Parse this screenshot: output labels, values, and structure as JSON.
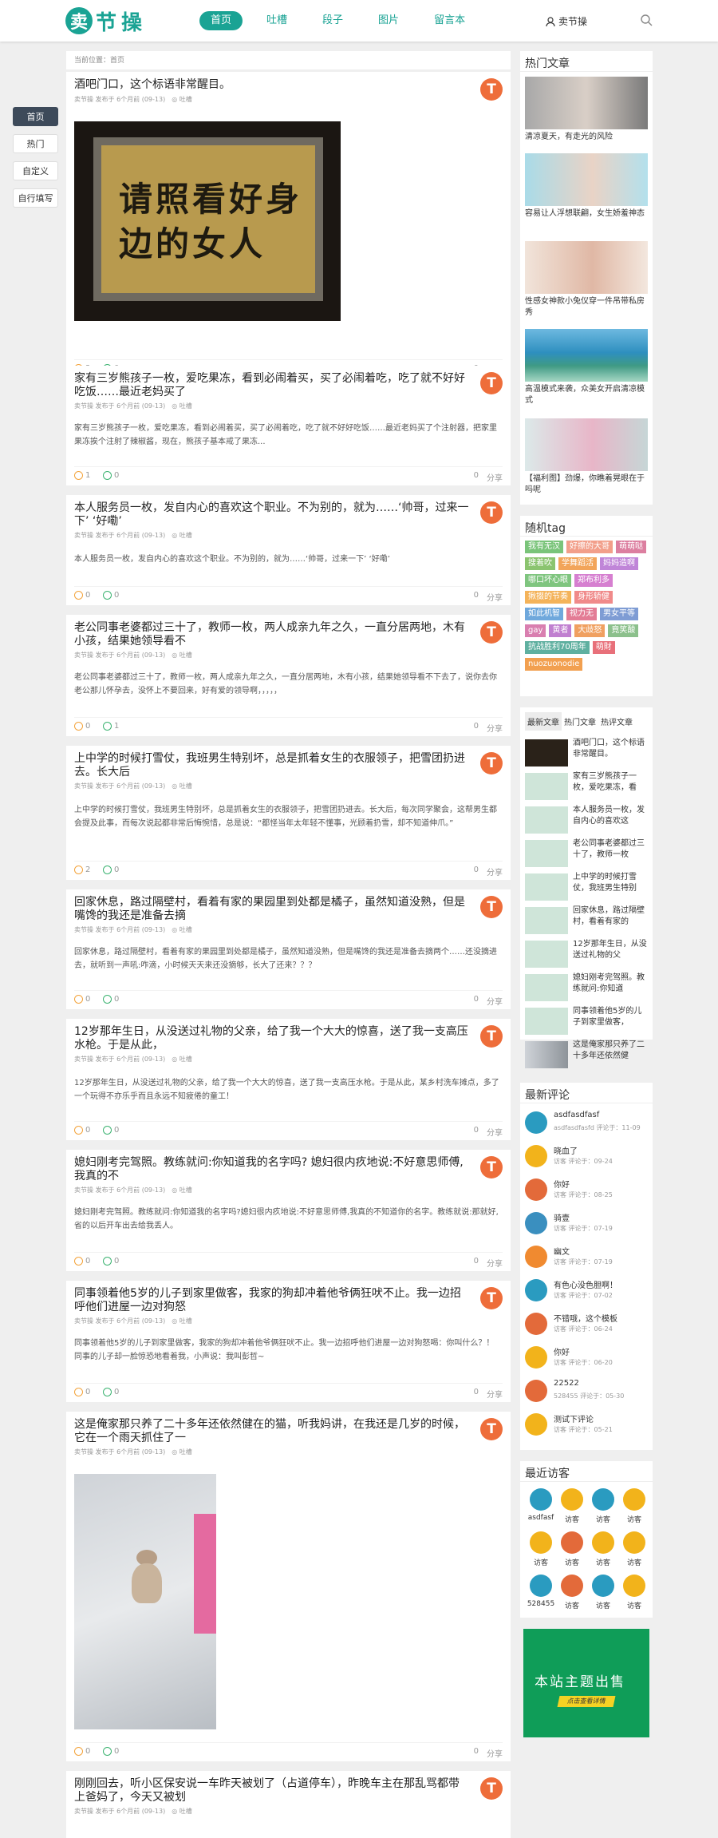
{
  "header": {
    "logo_badge": "卖",
    "logo_text": "节操",
    "nav": [
      "首页",
      "吐槽",
      "段子",
      "图片",
      "留言本"
    ],
    "user": "卖节操"
  },
  "sidenav": [
    "首页",
    "热门",
    "自定义",
    "自行填写"
  ],
  "crumb": "当前位置：首页",
  "posts": [
    {
      "title": "酒吧门口，这个标语非常醒目。",
      "meta": "卖节操 发布于 6个月前 (09-13)　◎ 吐槽",
      "body": "",
      "up": "3",
      "down": "0",
      "cm": "0",
      "share": "分享",
      "img": "请照看好身边的女人"
    },
    {
      "title": "家有三岁熊孩子一枚，爱吃果冻，看到必闹着买，买了必闹着吃，吃了就不好好吃饭……最近老妈买了",
      "meta": "卖节操 发布于 6个月前 (09-13)　◎ 吐槽",
      "body": "家有三岁熊孩子一枚，爱吃果冻，看到必闹着买，买了必闹着吃，吃了就不好好吃饭……最近老妈买了个注射器，把家里果冻挨个注射了辣椒酱，现在，熊孩子基本戒了果冻...",
      "up": "1",
      "down": "0",
      "cm": "0",
      "share": "分享"
    },
    {
      "title": "本人服务员一枚，发自内心的喜欢这个职业。不为别的，就为……‘帅哥，过来一下’ ‘好嘞’",
      "meta": "卖节操 发布于 6个月前 (09-13)　◎ 吐槽",
      "body": "本人服务员一枚，发自内心的喜欢这个职业。不为别的，就为……‘帅哥，过来一下’ ‘好嘞’",
      "up": "0",
      "down": "0",
      "cm": "0",
      "share": "分享"
    },
    {
      "title": "老公同事老婆都过三十了，教师一枚，两人成亲九年之久，一直分居两地，木有小孩，结果她领导看不",
      "meta": "卖节操 发布于 6个月前 (09-13)　◎ 吐槽",
      "body": "老公同事老婆都过三十了，教师一枚，两人成亲九年之久，一直分居两地，木有小孩，结果她领导看不下去了，说你去你老公那儿怀孕去，没怀上不要回来，好有爱的领导啊，，，，，",
      "up": "0",
      "down": "1",
      "cm": "0",
      "share": "分享"
    },
    {
      "title": "上中学的时候打雪仗，我班男生特别坏，总是抓着女生的衣服领子，把雪团扔进去。长大后",
      "meta": "卖节操 发布于 6个月前 (09-13)　◎ 吐槽",
      "body": "上中学的时候打雪仗，我班男生特别坏，总是抓着女生的衣服领子，把雪团扔进去。长大后，每次同学聚会，这帮男生都会提及此事，而每次说起都非常后悔惋惜，总是说：“都怪当年太年轻不懂事，光顾着扔雪，却不知道伸爪。”",
      "up": "2",
      "down": "0",
      "cm": "0",
      "share": "分享"
    },
    {
      "title": "回家休息，路过隔壁村，看着有家的果园里到处都是橘子，虽然知道没熟，但是嘴馋的我还是准备去摘",
      "meta": "卖节操 发布于 6个月前 (09-13)　◎ 吐槽",
      "body": "回家休息，路过隔壁村，看着有家的果园里到处都是橘子，虽然知道没熟，但是嘴馋的我还是准备去摘两个……还没摘进去，就听到一声吼:咋滴，小时候天天来还没摘够，长大了还来？？？",
      "up": "0",
      "down": "0",
      "cm": "0",
      "share": "分享"
    },
    {
      "title": "12岁那年生日，从没送过礼物的父亲，给了我一个大大的惊喜，送了我一支高压水枪。于是从此，",
      "meta": "卖节操 发布于 6个月前 (09-13)　◎ 吐槽",
      "body": "12岁那年生日，从没送过礼物的父亲，给了我一个大大的惊喜，送了我一支高压水枪。于是从此，某乡村洗车摊点，多了一个玩得不亦乐乎而且永远不知疲倦的童工！",
      "up": "0",
      "down": "0",
      "cm": "0",
      "share": "分享"
    },
    {
      "title": "媳妇刚考完驾照。教练就问:你知道我的名字吗? 媳妇很内疚地说:不好意思师傅,我真的不",
      "meta": "卖节操 发布于 6个月前 (09-13)　◎ 吐槽",
      "body": "媳妇刚考完驾照。教练就问:你知道我的名字吗?媳妇很内疚地说:不好意思师傅,我真的不知道你的名字。教练就说:那就好,省的以后开车出去给我丢人。",
      "up": "0",
      "down": "0",
      "cm": "0",
      "share": "分享"
    },
    {
      "title": "同事领着他5岁的儿子到家里做客，我家的狗却冲着他爷俩狂吠不止。我一边招呼他们进屋一边对狗怒",
      "meta": "卖节操 发布于 6个月前 (09-13)　◎ 吐槽",
      "body": "同事领着他5岁的儿子到家里做客，我家的狗却冲着他爷俩狂吠不止。我一边招呼他们进屋一边对狗怒喝：你叫什么？！同事的儿子却一脸惊恐地看着我，小声说：我叫彭哲~",
      "up": "0",
      "down": "0",
      "cm": "0",
      "share": "分享"
    },
    {
      "title": "这是俺家那只养了二十多年还依然健在的猫，听我妈讲，在我还是几岁的时候，它在一个雨天抓住了一",
      "meta": "卖节操 发布于 6个月前 (09-13)　◎ 吐槽",
      "body": "",
      "up": "0",
      "down": "0",
      "cm": "0",
      "share": "分享"
    },
    {
      "title": "刚刚回去，听小区保安说一车昨天被划了（占道停车），昨晚车主在那乱骂都带上爸妈了，今天又被划",
      "meta": "卖节操 发布于 6个月前 (09-13)　◎ 吐槽",
      "body": "",
      "up": "",
      "down": "",
      "cm": "",
      "share": ""
    }
  ],
  "hot": {
    "title": "热门文章",
    "items": [
      "清凉夏天，有走光的风险",
      "容易让人浮想联翩，女生娇羞神态",
      "性感女神款小兔仪穿一件吊带私房秀",
      "高温模式来袭，众美女开启清凉模式",
      "【福利图】劲爆，你瞧着晃眼在于吗呢"
    ]
  },
  "tags": {
    "title": "随机tag",
    "items": [
      {
        "t": "我有无汉",
        "c": "#7ac47a"
      },
      {
        "t": "好擦的大哥",
        "c": "#f29f8a"
      },
      {
        "t": "萌萌哒",
        "c": "#dc7fa0"
      },
      {
        "t": "搜着吹",
        "c": "#8bc46f"
      },
      {
        "t": "学舞蹈活",
        "c": "#f2a55a"
      },
      {
        "t": "妈妈造啊",
        "c": "#c085d8"
      },
      {
        "t": "哪口坏心眼",
        "c": "#7fc57f"
      },
      {
        "t": "郑布利多",
        "c": "#d67fd0"
      },
      {
        "t": "揪掇的节奏",
        "c": "#f4b35a"
      },
      {
        "t": "身形轿健",
        "c": "#f08a8a"
      },
      {
        "t": "如此机智",
        "c": "#6fa8dc"
      },
      {
        "t": "视力无",
        "c": "#e37c95"
      },
      {
        "t": "男女平等",
        "c": "#7e9cd4"
      },
      {
        "t": "gay",
        "c": "#d97fb0"
      },
      {
        "t": "黄者",
        "c": "#c07fd0"
      },
      {
        "t": "大歧怒",
        "c": "#f0a060"
      },
      {
        "t": "竟笑酸",
        "c": "#8cc08c"
      },
      {
        "t": "抗战胜利70周年",
        "c": "#5fb0a0"
      },
      {
        "t": "萌財",
        "c": "#e8707a"
      },
      {
        "t": "nuozuonodie",
        "c": "#f2a050"
      }
    ]
  },
  "newlist": {
    "tabs": [
      "最新文章",
      "热门文章",
      "热评文章"
    ],
    "items": [
      "酒吧门口，这个标语非常醒目。",
      "家有三岁熊孩子一枚，爱吃果冻，看",
      "本人服务员一枚，发自内心的喜欢这",
      "老公同事老婆都过三十了，教师一枚",
      "上中学的时候打雪仗，我班男生特别",
      "回家休息，路过隔壁村，看着有家的",
      "12岁那年生日，从没送过礼物的父",
      "媳妇刚考完驾照。教练就问:你知道",
      "同事领着他5岁的儿子到家里做客，",
      "这是俺家那只养了二十多年还依然健"
    ]
  },
  "comments": {
    "title": "最新评论",
    "items": [
      {
        "n": "asdfasdfasf",
        "s": "asdfasdfasfd 评论于：11-09"
      },
      {
        "n": "晓血了",
        "s": "访客 评论于：09-24"
      },
      {
        "n": "你好",
        "s": "访客 评论于：08-25"
      },
      {
        "n": "骑壹",
        "s": "访客 评论于：07-19"
      },
      {
        "n": "幽文",
        "s": "访客 评论于：07-19"
      },
      {
        "n": "有色心没色胆啊！",
        "s": "访客 评论于：07-02"
      },
      {
        "n": "不错哦，这个模板",
        "s": "访客 评论于：06-24"
      },
      {
        "n": "你好",
        "s": "访客 评论于：06-20"
      },
      {
        "n": "22522",
        "s": "528455 评论于：05-30"
      },
      {
        "n": "测试下评论",
        "s": "访客 评论于：05-21"
      }
    ]
  },
  "visitors": {
    "title": "最近访客",
    "items": [
      "asdfasf",
      "访客",
      "访客",
      "访客",
      "访客",
      "访客",
      "访客",
      "访客",
      "528455",
      "访客",
      "访客",
      "访客"
    ]
  },
  "ad": {
    "main": "本站主题出售",
    "sub": "点击查看详情"
  }
}
